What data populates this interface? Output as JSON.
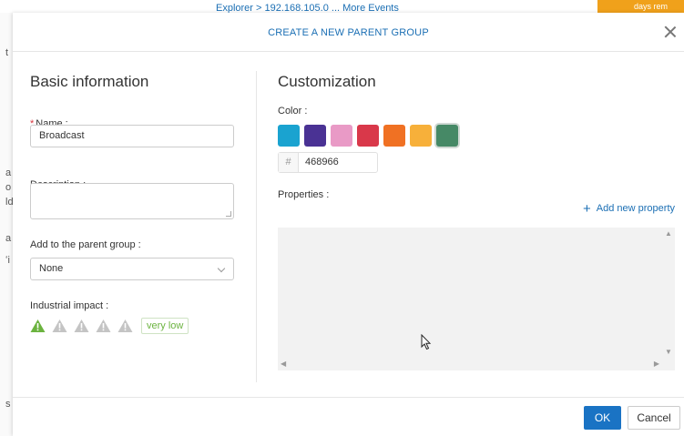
{
  "background": {
    "topbar_text": "Explorer > 192.168.105.0 ... More Events",
    "topbar_badge": "days rem",
    "left_edge_chars": [
      "t",
      "a",
      "o",
      "ld",
      "a",
      "ʻi",
      "s"
    ]
  },
  "modal": {
    "title": "CREATE A NEW PARENT GROUP",
    "basic": {
      "section_title": "Basic information",
      "name_required_mark": "*",
      "name_label": "Name :",
      "name_value": "Broadcast",
      "description_label": "Description :",
      "description_value": "",
      "parent_label": "Add to the parent group :",
      "parent_value": "None",
      "impact_label": "Industrial impact :",
      "impact_level": 1,
      "impact_max": 5,
      "impact_badge": "very low",
      "impact_active_color": "#6bb33f",
      "impact_inactive_color": "#c4c4c4"
    },
    "custom": {
      "section_title": "Customization",
      "color_label": "Color :",
      "swatches": [
        "#1aa3d0",
        "#4a3294",
        "#e99ac6",
        "#d9384a",
        "#f07123",
        "#f7b03a",
        "#468966"
      ],
      "selected_index": 6,
      "hex_prefix": "#",
      "hex_value": "468966",
      "properties_label": "Properties :",
      "add_property_label": "Add new property"
    },
    "footer": {
      "ok_label": "OK",
      "cancel_label": "Cancel"
    }
  }
}
